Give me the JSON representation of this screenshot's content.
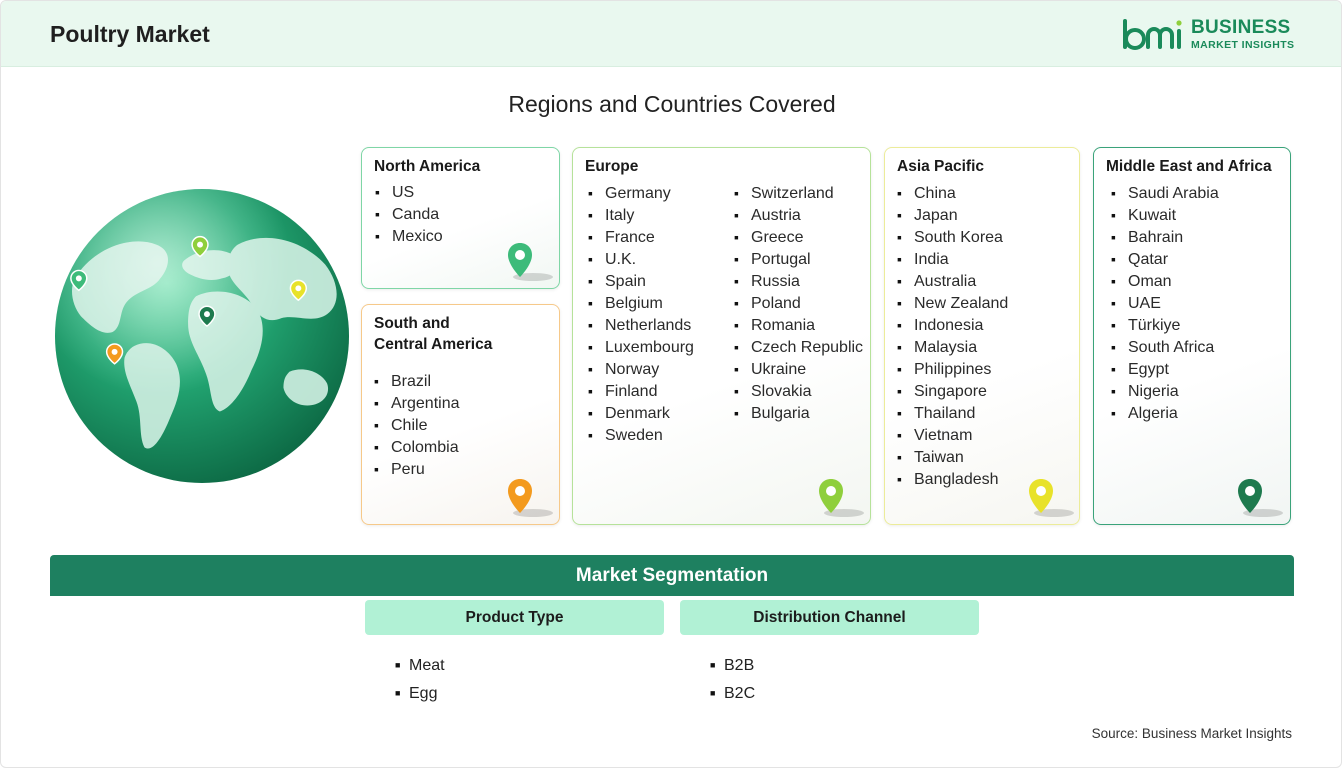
{
  "header": {
    "title": "Poultry Market",
    "logo_line1": "BUSINESS",
    "logo_line2": "MARKET INSIGHTS",
    "logo_mark_text": "bmi"
  },
  "regions_title": "Regions and Countries Covered",
  "regions": {
    "north_america": {
      "title": "North America",
      "pin_color": "#3dbb7a",
      "countries": [
        "US",
        "Canda",
        "Mexico"
      ]
    },
    "south_central_america": {
      "title_line1": "South and",
      "title_line2": "Central America",
      "pin_color": "#f39a1e",
      "countries": [
        "Brazil",
        "Argentina",
        "Chile",
        "Colombia",
        "Peru"
      ]
    },
    "europe": {
      "title": "Europe",
      "pin_color": "#8fcf3c",
      "countries_col1": [
        "Germany",
        "Italy",
        "France",
        "U.K.",
        "Spain",
        "Belgium",
        "Netherlands",
        "Luxembourg",
        "Norway",
        "Finland",
        "Denmark",
        "Sweden"
      ],
      "countries_col2": [
        "Switzerland",
        "Austria",
        "Greece",
        "Portugal",
        "Russia",
        "Poland",
        "Romania",
        "Czech Republic",
        "Ukraine",
        "Slovakia",
        "Bulgaria"
      ]
    },
    "asia_pacific": {
      "title": "Asia Pacific",
      "pin_color": "#e8e22a",
      "countries": [
        "China",
        "Japan",
        "South Korea",
        "India",
        "Australia",
        "New Zealand",
        "Indonesia",
        "Malaysia",
        "Philippines",
        "Singapore",
        "Thailand",
        "Vietnam",
        "Taiwan",
        "Bangladesh"
      ]
    },
    "middle_east_africa": {
      "title": "Middle East and Africa",
      "pin_color": "#1e7a4e",
      "countries": [
        "Saudi Arabia",
        "Kuwait",
        "Bahrain",
        "Qatar",
        "Oman",
        "UAE",
        "Türkiye",
        "South Africa",
        "Egypt",
        "Nigeria",
        "Algeria"
      ]
    }
  },
  "segmentation": {
    "title": "Market Segmentation",
    "product_type": {
      "title": "Product Type",
      "items": [
        "Meat",
        "Egg"
      ]
    },
    "distribution_channel": {
      "title": "Distribution Channel",
      "items": [
        "B2B",
        "B2C"
      ]
    }
  },
  "source": "Source: Business Market Insights",
  "colors": {
    "accent": "#1e8060",
    "header_bg": "#e9f8ef",
    "segment_head_bg": "#b1f1d5"
  }
}
